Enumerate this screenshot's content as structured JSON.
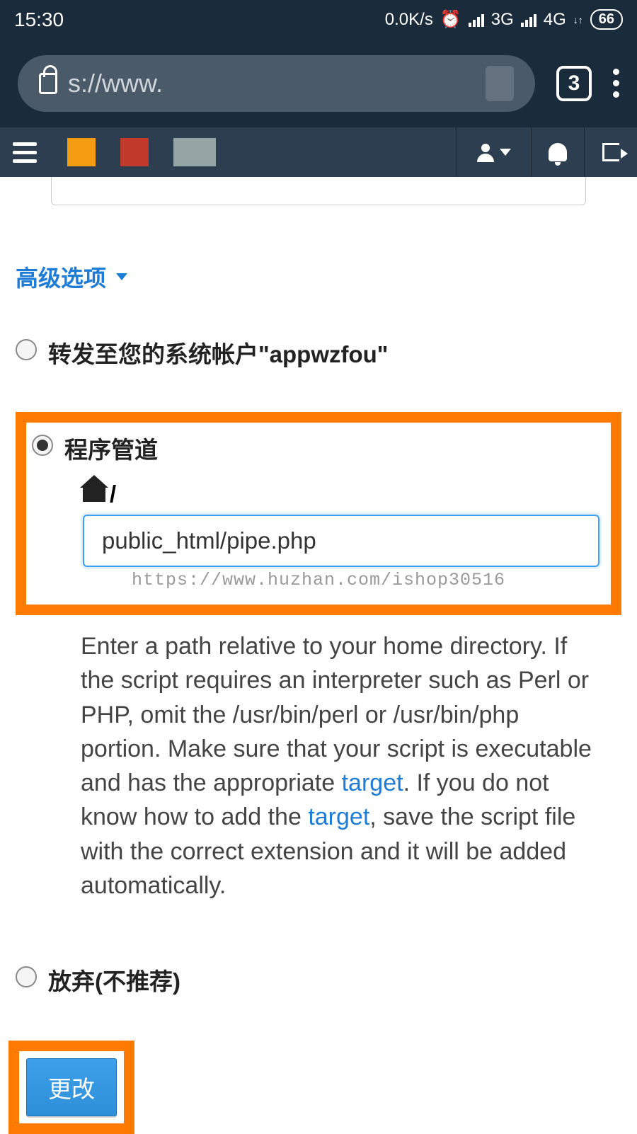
{
  "status_bar": {
    "time": "15:30",
    "speed": "0.0K/s",
    "network1": "3G",
    "network2": "4G",
    "battery": "66"
  },
  "browser": {
    "url_prefix": "s://www.",
    "tab_count": "3"
  },
  "page": {
    "advanced_options": "高级选项",
    "options": {
      "forward": {
        "label": "转发至您的系统帐户\"appwzfou\""
      },
      "pipe": {
        "label": "程序管道",
        "path_prefix": "/",
        "path_value": "public_html/pipe.php"
      },
      "discard": {
        "label": "放弃(不推荐)"
      }
    },
    "watermark": "https://www.huzhan.com/ishop30516",
    "help": {
      "part1": "Enter a path relative to your home directory. If the script requires an interpreter such as Perl or PHP, omit the /usr/bin/perl or /usr/bin/php portion. Make sure that your script is executable and has the appropriate ",
      "link1": "target",
      "part2": ". If you do not know how to add the ",
      "link2": "target",
      "part3": ", save the script file with the correct extension and it will be added automatically."
    },
    "submit_label": "更改"
  }
}
